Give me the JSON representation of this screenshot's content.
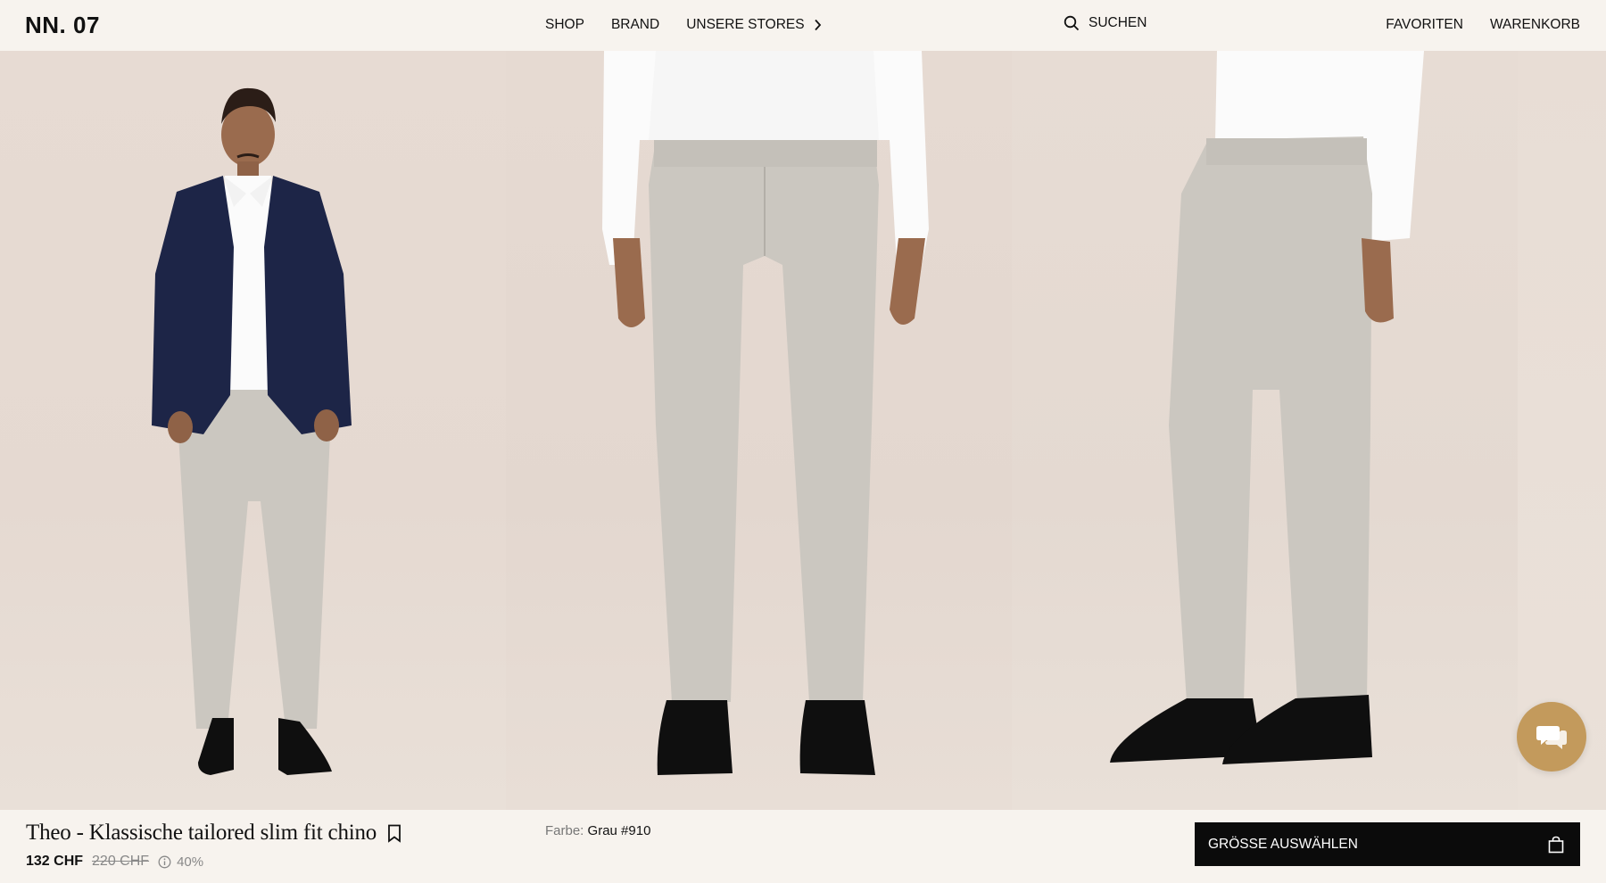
{
  "header": {
    "logo": "NN. 07",
    "nav": [
      {
        "label": "SHOP"
      },
      {
        "label": "BRAND"
      },
      {
        "label": "UNSERE STORES"
      }
    ],
    "search_label": "SUCHEN",
    "favorites_label": "FAVORITEN",
    "cart_label": "WARENKORB"
  },
  "gallery": {
    "images": [
      "full-look-front",
      "trousers-front",
      "trousers-side"
    ],
    "colors": {
      "background": "#e6dad2",
      "trousers": "#cbc7c0",
      "shirt": "#ffffff",
      "jacket": "#1d2547",
      "shoes": "#0f0f0f"
    }
  },
  "product": {
    "title": "Theo - Klassische tailored slim fit chino",
    "price": "132 CHF",
    "old_price": "220 CHF",
    "discount": "40%",
    "color_label": "Farbe:",
    "color_value": "Grau #910",
    "cta_label": "GRÖSSE AUSWÄHLEN"
  },
  "chat": {
    "icon": "chat-bubble-icon",
    "color": "#c39a5c"
  },
  "icons": {
    "search": "search-icon",
    "stores_chevron": "chevron-right-icon",
    "bookmark": "bookmark-icon",
    "info": "info-icon",
    "bag": "shopping-bag-icon"
  }
}
